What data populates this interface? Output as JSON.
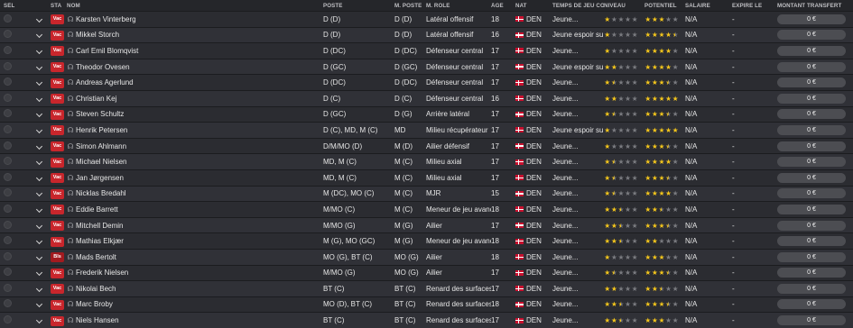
{
  "headers": {
    "sel": "SÉL",
    "sta": "STA",
    "nom": "NOM",
    "poste": "POSTE",
    "mposte": "M. POSTE",
    "role": "M. RÔLE",
    "age": "ÂGE",
    "nat": "NAT",
    "temps": "TEMPS DE JEU CON...",
    "niveau": "NIVEAU",
    "potentiel": "POTENTIEL",
    "salaire": "SALAIRE",
    "expire": "EXPIRE LE",
    "montant": "MONTANT TRANSFERT"
  },
  "rows": [
    {
      "sta": "Vac",
      "name": "Karsten Vinterberg",
      "poste": "D (D)",
      "mposte": "D (D)",
      "role": "Latéral offensif",
      "age": "18",
      "nat": "DEN",
      "temps": "Jeune...",
      "niveau": 1,
      "potentiel": 3,
      "salaire": "N/A",
      "expire": "-",
      "montant": "0 €"
    },
    {
      "sta": "Vac",
      "name": "Mikkel Storch",
      "poste": "D (D)",
      "mposte": "D (D)",
      "role": "Latéral offensif",
      "age": "16",
      "nat": "DEN",
      "temps": "Jeune espoir sur...",
      "niveau": 1,
      "potentiel": 4.5,
      "salaire": "N/A",
      "expire": "-",
      "montant": "0 €"
    },
    {
      "sta": "Vac",
      "name": "Carl Emil Blomqvist",
      "poste": "D (DC)",
      "mposte": "D (DC)",
      "role": "Défenseur central",
      "age": "17",
      "nat": "DEN",
      "temps": "Jeune...",
      "niveau": 1,
      "potentiel": 4,
      "salaire": "N/A",
      "expire": "-",
      "montant": "0 €"
    },
    {
      "sta": "Vac",
      "name": "Theodor Ovesen",
      "poste": "D (GC)",
      "mposte": "D (GC)",
      "role": "Défenseur central",
      "age": "17",
      "nat": "DEN",
      "temps": "Jeune espoir sur...",
      "niveau": 2,
      "potentiel": 4,
      "salaire": "N/A",
      "expire": "-",
      "montant": "0 €"
    },
    {
      "sta": "Vac",
      "name": "Andreas Agerlund",
      "poste": "D (DC)",
      "mposte": "D (DC)",
      "role": "Défenseur central",
      "age": "17",
      "nat": "DEN",
      "temps": "Jeune...",
      "niveau": 1.5,
      "potentiel": 3.5,
      "salaire": "N/A",
      "expire": "-",
      "montant": "0 €"
    },
    {
      "sta": "Vac",
      "name": "Christian Kej",
      "poste": "D (C)",
      "mposte": "D (C)",
      "role": "Défenseur central",
      "age": "16",
      "nat": "DEN",
      "temps": "Jeune...",
      "niveau": 2,
      "potentiel": 5,
      "salaire": "N/A",
      "expire": "-",
      "montant": "0 €"
    },
    {
      "sta": "Vac",
      "name": "Steven Schultz",
      "poste": "D (GC)",
      "mposte": "D (G)",
      "role": "Arrière latéral",
      "age": "17",
      "nat": "DEN",
      "temps": "Jeune...",
      "niveau": 1.5,
      "potentiel": 3.5,
      "salaire": "N/A",
      "expire": "-",
      "montant": "0 €"
    },
    {
      "sta": "Vac",
      "name": "Henrik Petersen",
      "poste": "D (C), MD, M (C)",
      "mposte": "MD",
      "role": "Milieu récupérateur",
      "age": "17",
      "nat": "DEN",
      "temps": "Jeune espoir sur...",
      "niveau": 1,
      "potentiel": 5,
      "salaire": "N/A",
      "expire": "-",
      "montant": "0 €"
    },
    {
      "sta": "Vac",
      "name": "Simon Ahlmann",
      "poste": "D/M/MO (D)",
      "mposte": "M (D)",
      "role": "Ailier défensif",
      "age": "17",
      "nat": "DEN",
      "temps": "Jeune...",
      "niveau": 1,
      "potentiel": 3.5,
      "salaire": "N/A",
      "expire": "-",
      "montant": "0 €"
    },
    {
      "sta": "Vac",
      "name": "Michael Nielsen",
      "poste": "MD, M (C)",
      "mposte": "M (C)",
      "role": "Milieu axial",
      "age": "17",
      "nat": "DEN",
      "temps": "Jeune...",
      "niveau": 1.5,
      "potentiel": 4,
      "salaire": "N/A",
      "expire": "-",
      "montant": "0 €"
    },
    {
      "sta": "Vac",
      "name": "Jan Jørgensen",
      "poste": "MD, M (C)",
      "mposte": "M (C)",
      "role": "Milieu axial",
      "age": "17",
      "nat": "DEN",
      "temps": "Jeune...",
      "niveau": 1.5,
      "potentiel": 3.5,
      "salaire": "N/A",
      "expire": "-",
      "montant": "0 €"
    },
    {
      "sta": "Vac",
      "name": "Nicklas Bredahl",
      "poste": "M (DC), MO (C)",
      "mposte": "M (C)",
      "role": "MJR",
      "age": "15",
      "nat": "DEN",
      "temps": "Jeune...",
      "niveau": 1.5,
      "potentiel": 4,
      "salaire": "N/A",
      "expire": "-",
      "montant": "0 €"
    },
    {
      "sta": "Vac",
      "name": "Eddie Barrett",
      "poste": "M/MO (C)",
      "mposte": "M (C)",
      "role": "Meneur de jeu avancé",
      "age": "18",
      "nat": "DEN",
      "temps": "Jeune...",
      "niveau": 2.5,
      "potentiel": 2.5,
      "salaire": "N/A",
      "expire": "-",
      "montant": "0 €"
    },
    {
      "sta": "Vac",
      "name": "Mitchell Demin",
      "poste": "M/MO (G)",
      "mposte": "M (G)",
      "role": "Ailier",
      "age": "17",
      "nat": "DEN",
      "temps": "Jeune...",
      "niveau": 2.5,
      "potentiel": 3.5,
      "salaire": "N/A",
      "expire": "-",
      "montant": "0 €"
    },
    {
      "sta": "Vac",
      "name": "Mathias Elkjær",
      "poste": "M (G), MO (GC)",
      "mposte": "M (G)",
      "role": "Meneur de jeu avancé",
      "age": "18",
      "nat": "DEN",
      "temps": "Jeune...",
      "niveau": 2.5,
      "potentiel": 2,
      "salaire": "N/A",
      "expire": "-",
      "montant": "0 €"
    },
    {
      "sta": "Bls",
      "name": "Mads Bertolt",
      "poste": "MO (G), BT (C)",
      "mposte": "MO (G)",
      "role": "Ailier",
      "age": "18",
      "nat": "DEN",
      "temps": "Jeune...",
      "niveau": 1,
      "potentiel": 3,
      "salaire": "N/A",
      "expire": "-",
      "montant": "0 €"
    },
    {
      "sta": "Vac",
      "name": "Frederik Nielsen",
      "poste": "M/MO (G)",
      "mposte": "MO (G)",
      "role": "Ailier",
      "age": "17",
      "nat": "DEN",
      "temps": "Jeune...",
      "niveau": 1.5,
      "potentiel": 3.5,
      "salaire": "N/A",
      "expire": "-",
      "montant": "0 €"
    },
    {
      "sta": "Vac",
      "name": "Nikolai Bech",
      "poste": "BT (C)",
      "mposte": "BT (C)",
      "role": "Renard des surfaces",
      "age": "17",
      "nat": "DEN",
      "temps": "Jeune...",
      "niveau": 2,
      "potentiel": 2.5,
      "salaire": "N/A",
      "expire": "-",
      "montant": "0 €"
    },
    {
      "sta": "Vac",
      "name": "Marc Broby",
      "poste": "MO (D), BT (C)",
      "mposte": "BT (C)",
      "role": "Renard des surfaces",
      "age": "18",
      "nat": "DEN",
      "temps": "Jeune...",
      "niveau": 2.5,
      "potentiel": 3.5,
      "salaire": "N/A",
      "expire": "-",
      "montant": "0 €"
    },
    {
      "sta": "Vac",
      "name": "Niels Hansen",
      "poste": "BT (C)",
      "mposte": "BT (C)",
      "role": "Renard des surfaces",
      "age": "17",
      "nat": "DEN",
      "temps": "Jeune...",
      "niveau": 2.5,
      "potentiel": 3,
      "salaire": "N/A",
      "expire": "-",
      "montant": "0 €"
    }
  ],
  "icons": {
    "select": "radio-icon",
    "expand": "chevron-down-icon",
    "player": "headphones-icon",
    "flag": "denmark-flag-icon",
    "star": "star-icon"
  },
  "colors": {
    "star": "#f4c61c",
    "badge": "#c8262c",
    "background": "#26272b"
  }
}
